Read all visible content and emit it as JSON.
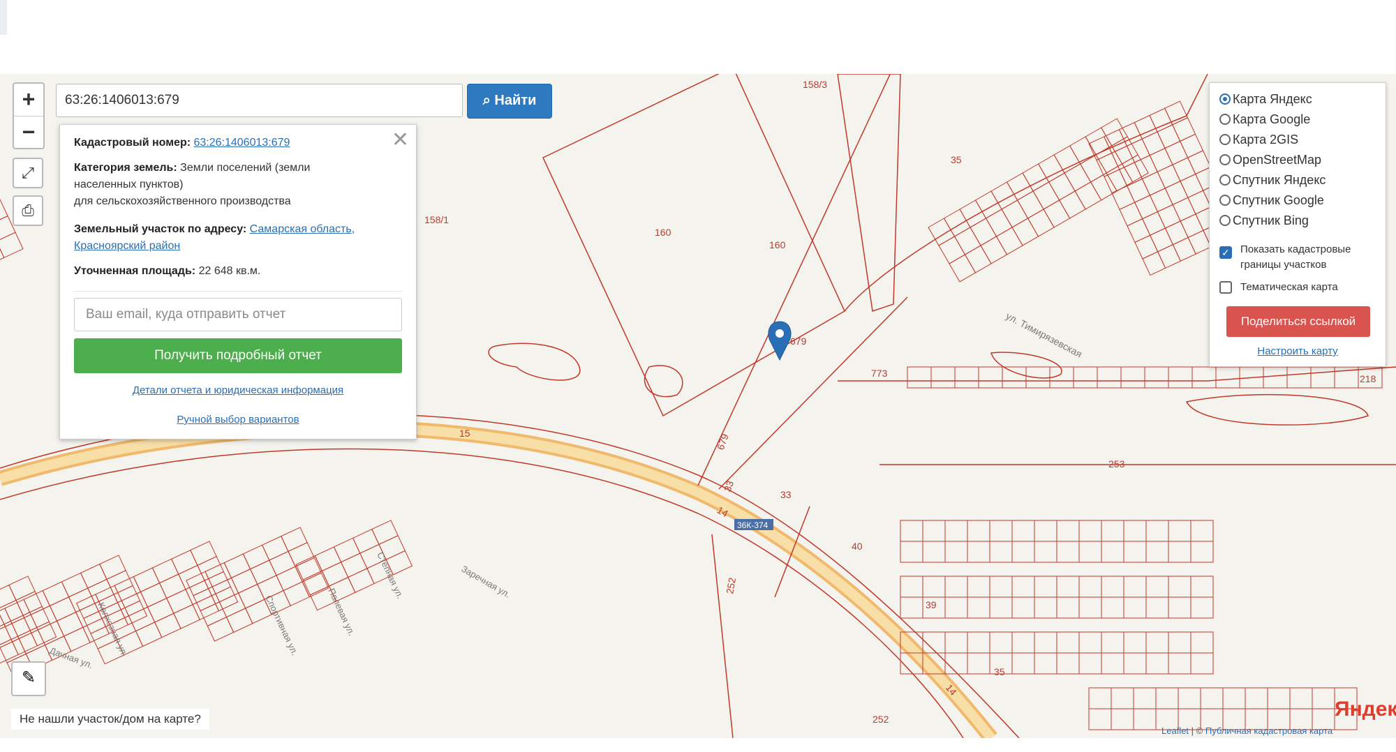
{
  "search": {
    "value": "63:26:1406013:679",
    "button_label": "Найти",
    "button_icon": "search-icon"
  },
  "zoom": {
    "in_label": "+",
    "out_label": "−"
  },
  "info_panel": {
    "close_label": "✕",
    "cadastral_label": "Кадастровый номер:",
    "cadastral_value": "63:26:1406013:679",
    "category_label": "Категория земель:",
    "category_value_1": "Земли поселений (земли",
    "category_value_2": "населенных пунктов)",
    "category_value_3": "для сельскохозяйственного производства",
    "address_label": "Земельный участок по адресу:",
    "address_link_1": "Самарская область,",
    "address_link_2": "Красноярский район",
    "area_label": "Уточненная площадь:",
    "area_value": "22 648 кв.м.",
    "email_placeholder": "Ваш email, куда отправить отчет",
    "report_button": "Получить подробный отчет",
    "details_link": "Детали отчета и юридическая информация",
    "manual_link": "Ручной выбор вариантов"
  },
  "layers": {
    "options": [
      {
        "label": "Карта Яндекс",
        "selected": true
      },
      {
        "label": "Карта Google",
        "selected": false
      },
      {
        "label": "Карта 2GIS",
        "selected": false
      },
      {
        "label": "OpenStreetMap",
        "selected": false
      },
      {
        "label": "Спутник Яндекс",
        "selected": false
      },
      {
        "label": "Спутник Google",
        "selected": false
      },
      {
        "label": "Спутник Bing",
        "selected": false
      }
    ],
    "show_borders_line1": "Показать кадастровые",
    "show_borders_line2": "границы участков",
    "show_borders_checked": true,
    "thematic_label": "Тематическая карта",
    "thematic_checked": false,
    "share_button": "Поделиться ссылкой",
    "configure_link": "Настроить карту"
  },
  "not_found_label": "Не нашли участок/дом на карте?",
  "attribution": {
    "leaflet": "Leaflet",
    "separator": " | © ",
    "source": "Публичная кадастровая карта"
  },
  "yandex_logo": "Яндекс",
  "map_labels": {
    "p158_3": "158/3",
    "p158_1": "158/1",
    "p35a": "35",
    "p160a": "160",
    "p160b": "160",
    "p679": "679",
    "p679b": "679",
    "p773": "773",
    "p15": "15",
    "p33a": "33",
    "p33b": "33",
    "p14a": "14",
    "p14b": "14",
    "road": "36К-374",
    "p253": "253",
    "p252a": "252",
    "p252b": "252",
    "p40": "40",
    "p39": "39",
    "p35b": "35",
    "p218": "218",
    "street1": "ул. Тимиря­зевская",
    "street2": "Заречная ул.",
    "street3": "Степная ул.",
    "street4": "Полевая ул.",
    "street5": "Спортивная ул.",
    "street6": "Дачная ул.",
    "street7": "Колхозная ул."
  },
  "colors": {
    "parcel_line": "#c0392b",
    "road_fill": "#f5d08a",
    "search_button": "#2d7ac0",
    "report_button": "#4cae4c",
    "share_button": "#d9534f",
    "marker": "#2a6fb5"
  }
}
